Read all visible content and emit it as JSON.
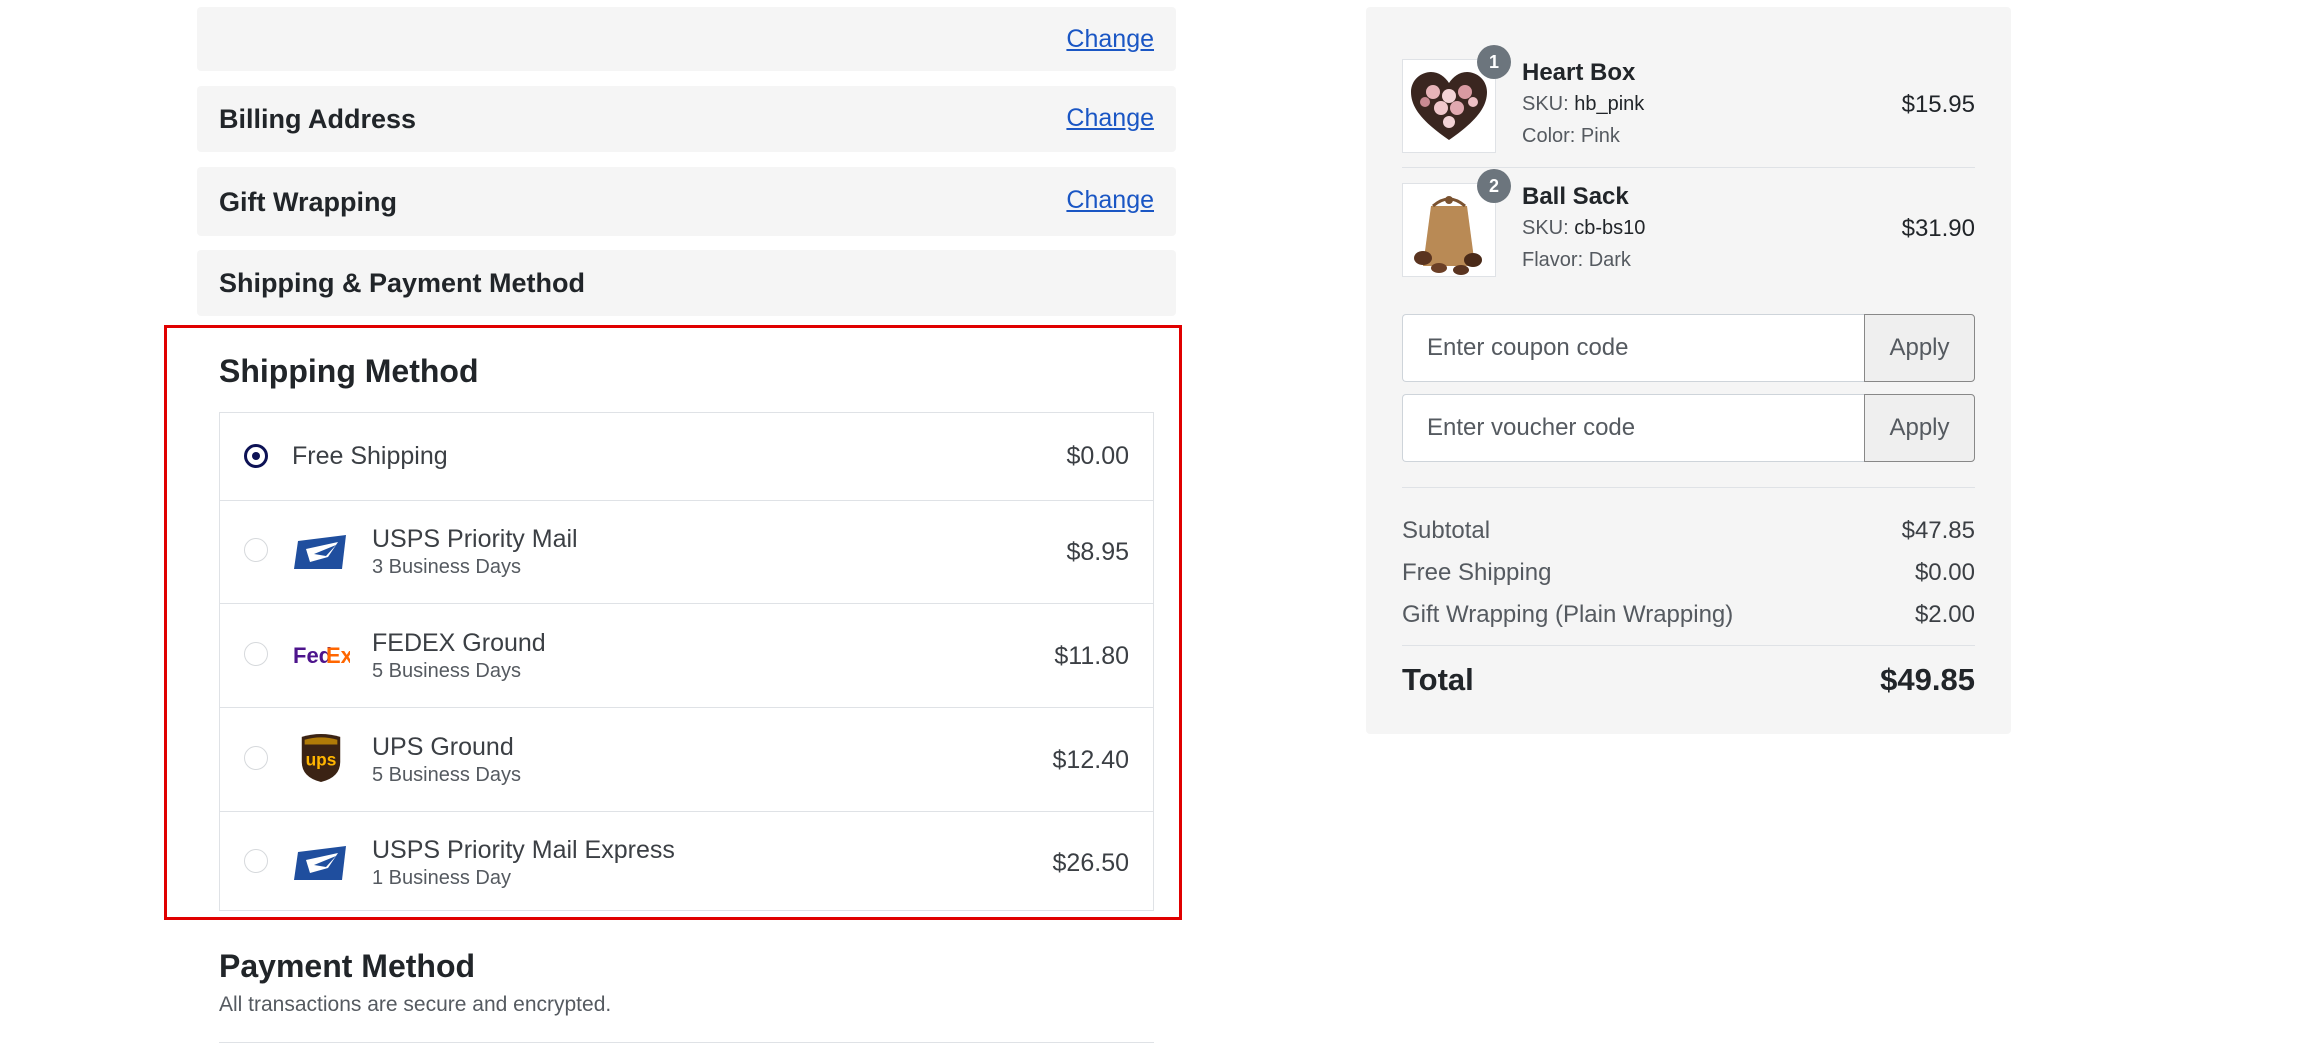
{
  "checkout_steps": [
    {
      "title": "",
      "change_label": "Change"
    },
    {
      "title": "Billing Address",
      "change_label": "Change"
    },
    {
      "title": "Gift Wrapping",
      "change_label": "Change"
    },
    {
      "title": "Shipping & Payment Method",
      "change_label": ""
    }
  ],
  "shipping": {
    "title": "Shipping Method",
    "options": [
      {
        "name": "Free Shipping",
        "eta": "",
        "price": "$0.00",
        "selected": true,
        "carrier_icon": ""
      },
      {
        "name": "USPS Priority Mail",
        "eta": "3 Business Days",
        "price": "$8.95",
        "selected": false,
        "carrier_icon": "usps-logo-icon"
      },
      {
        "name": "FEDEX Ground",
        "eta": "5 Business Days",
        "price": "$11.80",
        "selected": false,
        "carrier_icon": "fedex-logo-icon"
      },
      {
        "name": "UPS Ground",
        "eta": "5 Business Days",
        "price": "$12.40",
        "selected": false,
        "carrier_icon": "ups-logo-icon"
      },
      {
        "name": "USPS Priority Mail Express",
        "eta": "1 Business Day",
        "price": "$26.50",
        "selected": false,
        "carrier_icon": "usps-logo-icon"
      }
    ]
  },
  "payment": {
    "title": "Payment Method",
    "subtitle": "All transactions are secure and encrypted."
  },
  "order_summary": {
    "items": [
      {
        "qty": "1",
        "name": "Heart Box",
        "sku_label": "SKU: ",
        "sku": "hb_pink",
        "attr_label": "Color: ",
        "attr": "Pink",
        "price": "$15.95"
      },
      {
        "qty": "2",
        "name": "Ball Sack",
        "sku_label": "SKU: ",
        "sku": "cb-bs10",
        "attr_label": "Flavor: ",
        "attr": "Dark",
        "price": "$31.90"
      }
    ],
    "coupon": {
      "placeholder": "Enter coupon code",
      "button": "Apply"
    },
    "voucher": {
      "placeholder": "Enter voucher code",
      "button": "Apply"
    },
    "lines": [
      {
        "label": "Subtotal",
        "value": "$47.85"
      },
      {
        "label": "Free Shipping",
        "value": "$0.00"
      },
      {
        "label": "Gift Wrapping (Plain Wrapping)",
        "value": "$2.00"
      }
    ],
    "total": {
      "label": "Total",
      "value": "$49.85"
    }
  },
  "colors": {
    "accent": "#0d1255",
    "link": "#1a56c4",
    "highlight_border": "#e00000",
    "panel_bg": "#f5f5f5"
  }
}
